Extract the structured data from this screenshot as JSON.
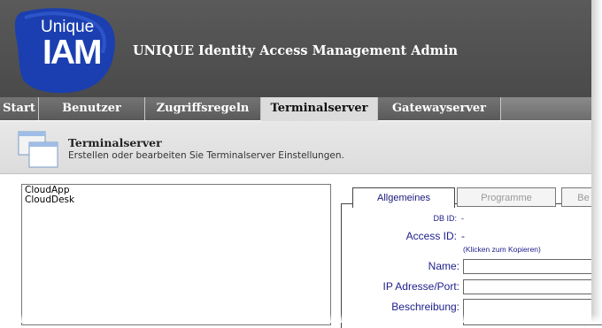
{
  "brand": {
    "logo_top": "Unique",
    "logo_main": "IAM",
    "title": "UNIQUE Identity Access Management Admin"
  },
  "nav": {
    "items": [
      {
        "label": "Start"
      },
      {
        "label": "Benutzer"
      },
      {
        "label": "Zugriffsregeln"
      },
      {
        "label": "Terminalserver",
        "active": true
      },
      {
        "label": "Gatewayserver"
      }
    ]
  },
  "page": {
    "title": "Terminalserver",
    "description": "Erstellen oder bearbeiten Sie Terminalserver Einstellungen."
  },
  "list": {
    "items": [
      "CloudApp",
      "CloudDesk"
    ]
  },
  "tabs": [
    {
      "label": "Allgemeines"
    },
    {
      "label": "Programme"
    },
    {
      "label": "Be"
    }
  ],
  "form": {
    "db_id_label": "DB ID:",
    "db_id_value": "-",
    "access_id_label": "Access ID:",
    "access_id_value": "-",
    "access_id_hint": "(Klicken zum Kopieren)",
    "name_label": "Name:",
    "name_value": "",
    "ip_label": "IP Adresse/Port:",
    "ip_value": "",
    "desc_label": "Beschreibung:",
    "desc_value": ""
  },
  "colors": {
    "logo_blue": "#1b3fb0",
    "header_bg": "#505050",
    "label_blue": "#1d1d8c"
  },
  "icons": {
    "logo": "unique-iam-logo",
    "page": "window-stack-icon"
  }
}
